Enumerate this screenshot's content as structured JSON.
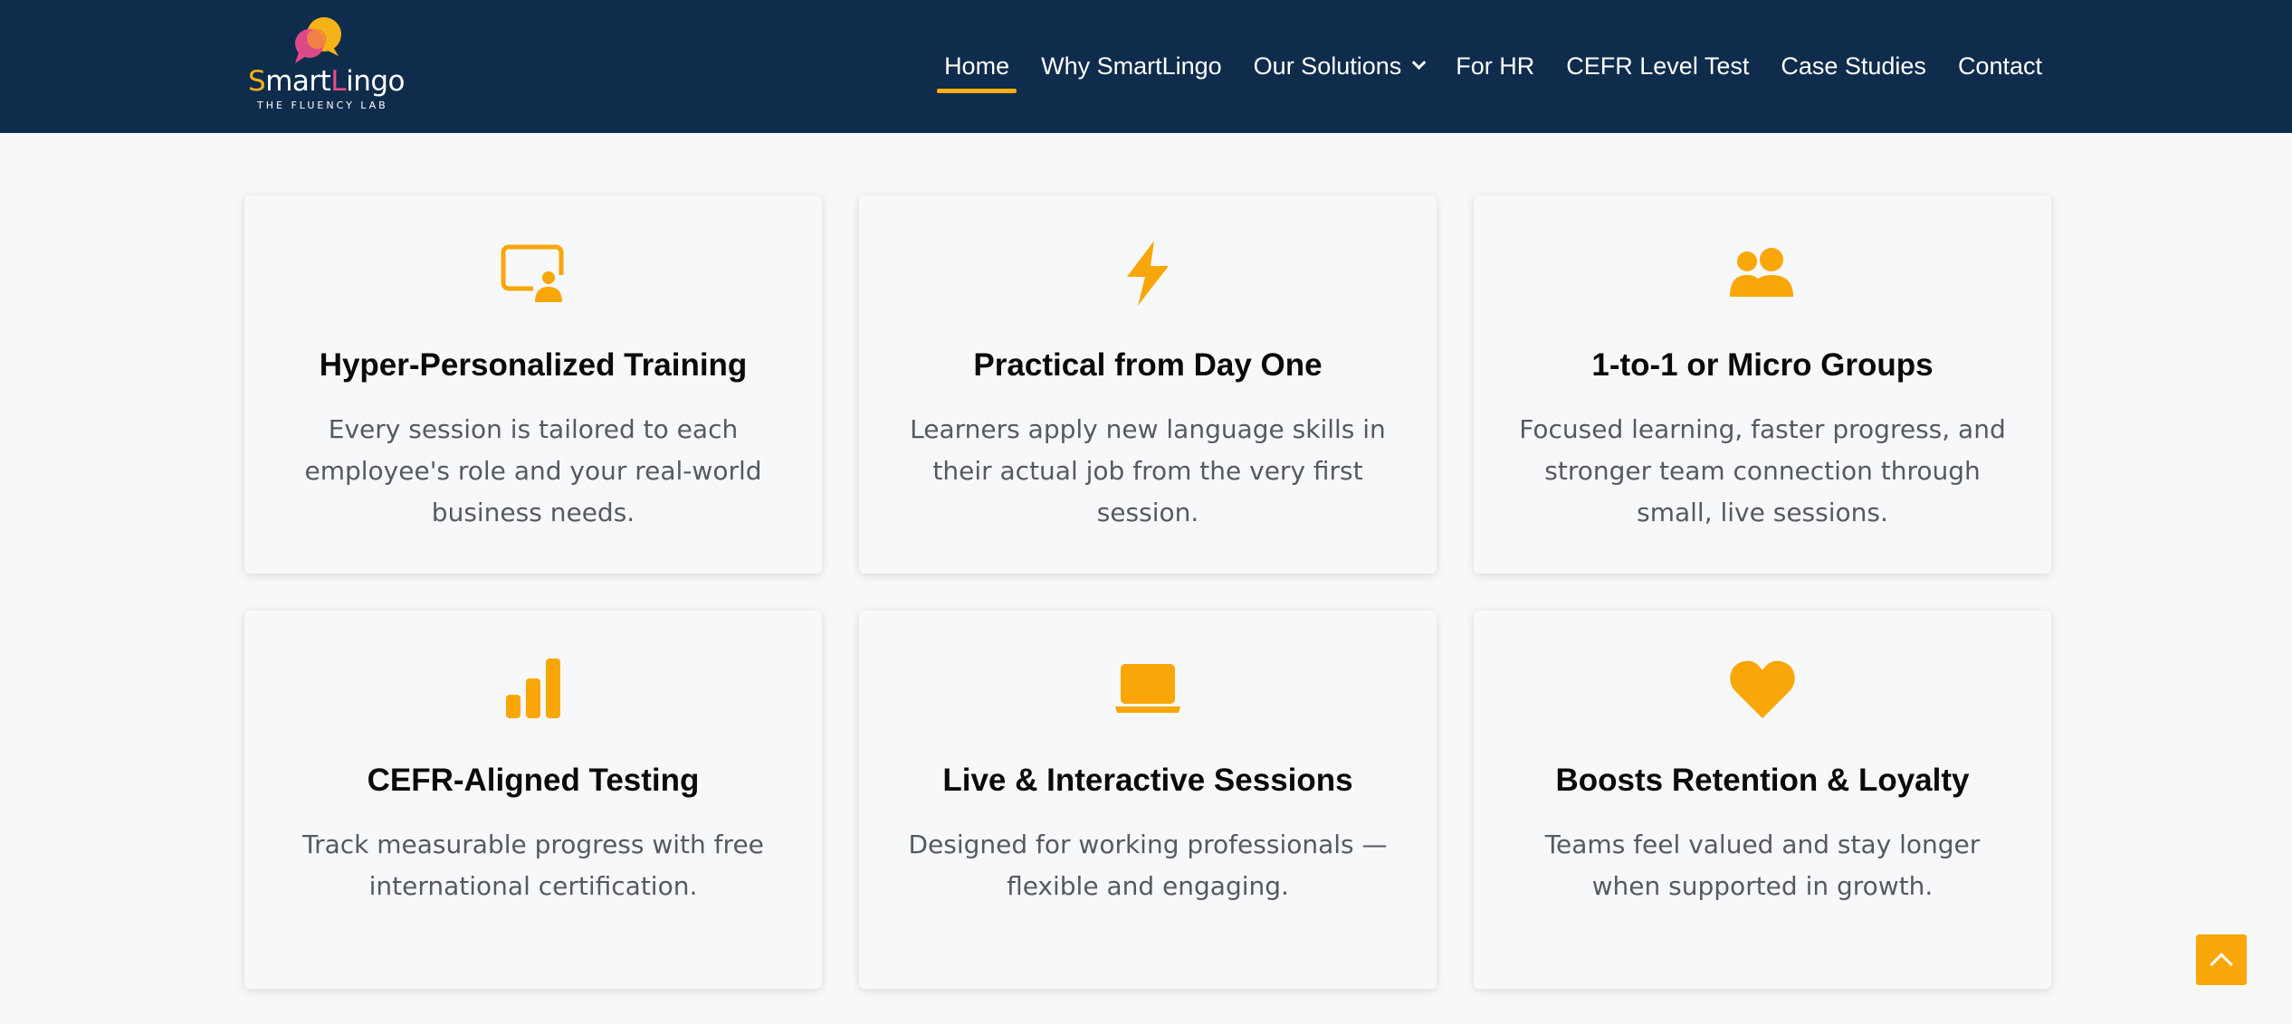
{
  "brand": {
    "name_parts": [
      "S",
      "mart",
      "L",
      "ingo"
    ],
    "tagline": "THE FLUENCY LAB",
    "colors": {
      "navy": "#0f2c4c",
      "accent": "#ffb011",
      "pink": "#e84b8a"
    }
  },
  "nav": {
    "items": [
      {
        "label": "Home",
        "active": true
      },
      {
        "label": "Why SmartLingo"
      },
      {
        "label": "Our Solutions",
        "has_dropdown": true
      },
      {
        "label": "For HR"
      },
      {
        "label": "CEFR Level Test"
      },
      {
        "label": "Case Studies"
      },
      {
        "label": "Contact"
      }
    ]
  },
  "features": [
    {
      "icon": "presentation-user-icon",
      "title": "Hyper-Personalized Training",
      "text": "Every session is tailored to each employee's role and your real-world business needs."
    },
    {
      "icon": "lightning-icon",
      "title": "Practical from Day One",
      "text": "Learners apply new language skills in their actual job from the very first session."
    },
    {
      "icon": "users-icon",
      "title": "1-to-1 or Micro Groups",
      "text": "Focused learning, faster progress, and stronger team connection through small, live sessions."
    },
    {
      "icon": "bar-chart-icon",
      "title": "CEFR-Aligned Testing",
      "text": "Track measurable progress with free international certification."
    },
    {
      "icon": "laptop-icon",
      "title": "Live & Interactive Sessions",
      "text": "Designed for working professionals — flexible and engaging."
    },
    {
      "icon": "heart-icon",
      "title": "Boosts Retention & Loyalty",
      "text": "Teams feel valued and stay longer when supported in growth."
    }
  ],
  "scroll_top": {
    "icon": "chevron-up-icon"
  }
}
